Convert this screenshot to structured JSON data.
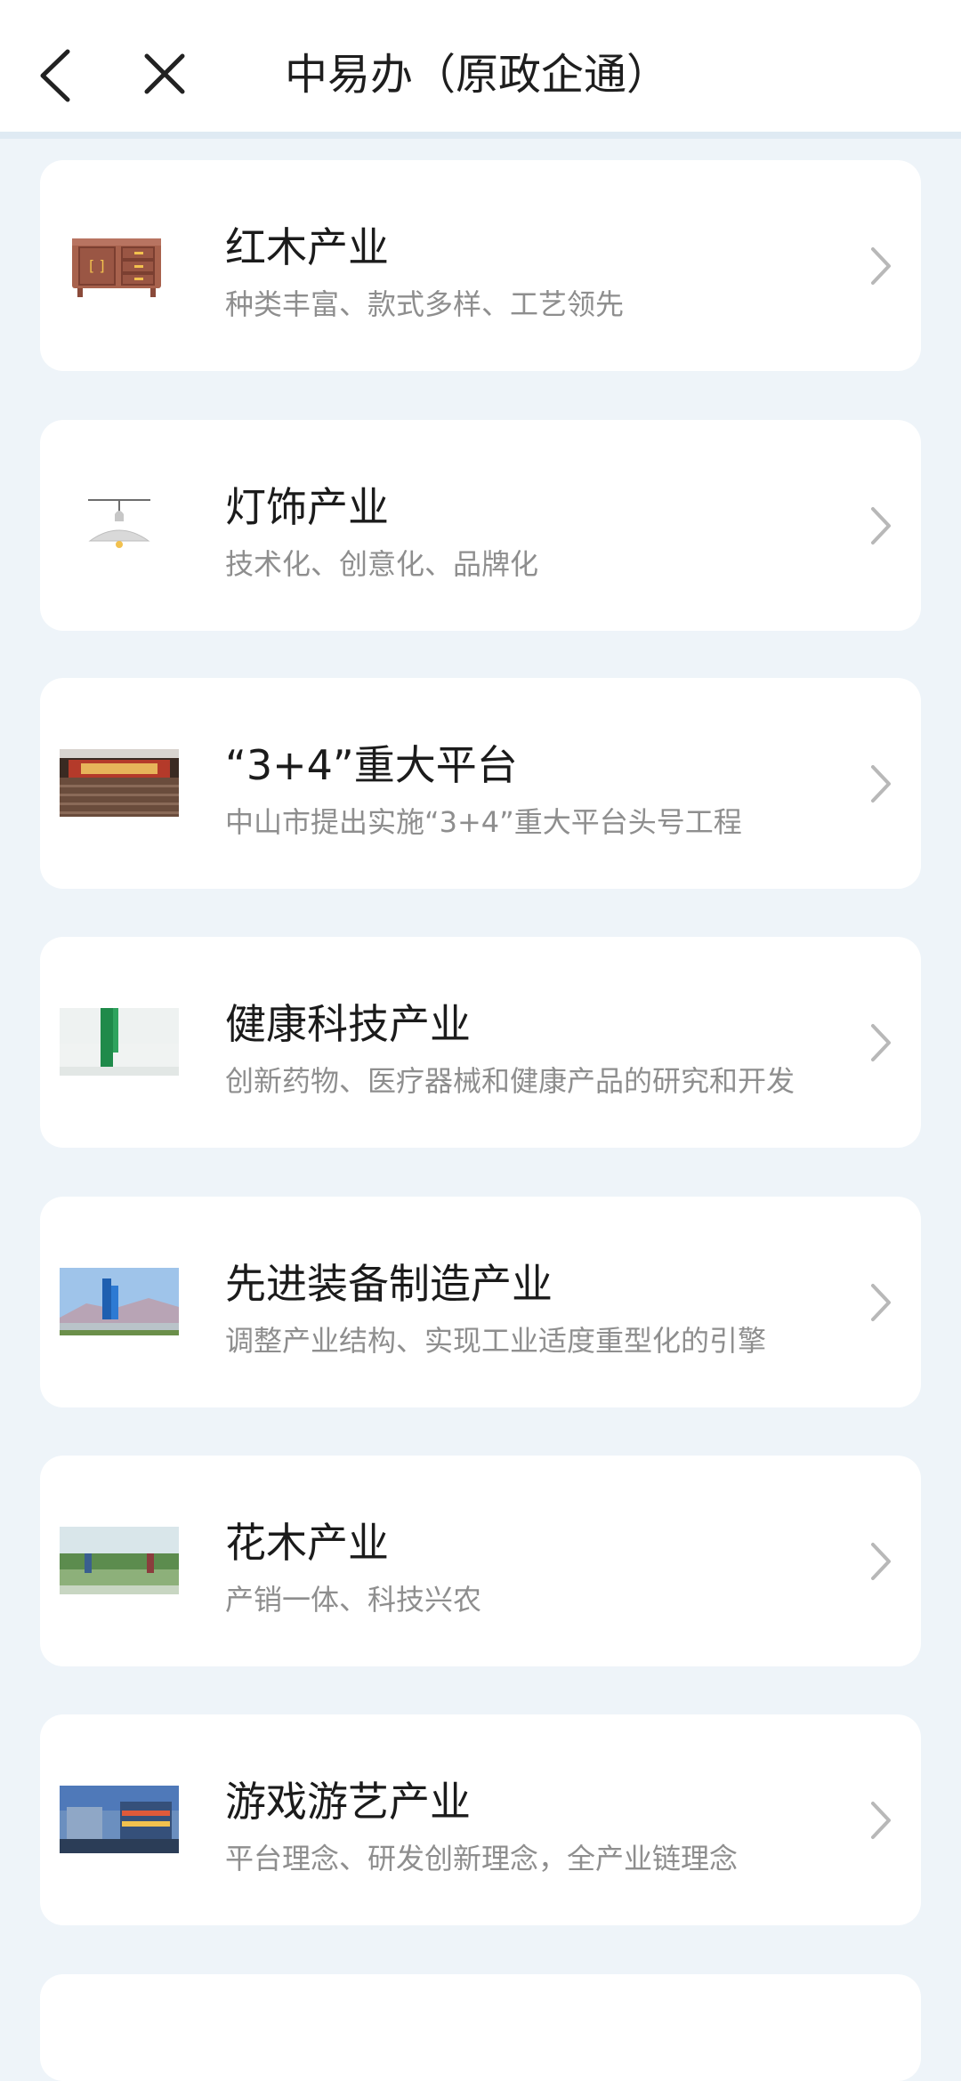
{
  "header": {
    "title": "中易办（原政企通）",
    "back_icon": "chevron-left-icon",
    "close_icon": "close-icon"
  },
  "items": [
    {
      "title": "红木产业",
      "subtitle": "种类丰富、款式多样、工艺领先",
      "thumb": "cabinet-image"
    },
    {
      "title": "灯饰产业",
      "subtitle": "技术化、创意化、品牌化",
      "thumb": "pendant-lamp-image"
    },
    {
      "title": "“3+4”重大平台",
      "subtitle": "中山市提出实施“3+4”重大平台头号工程",
      "thumb": "conference-hall-image"
    },
    {
      "title": "健康科技产业",
      "subtitle": "创新药物、医疗器械和健康产品的研究和开发",
      "thumb": "health-sign-image"
    },
    {
      "title": "先进装备制造产业",
      "subtitle": "调整产业结构、实现工业适度重型化的引擎",
      "thumb": "industrial-monument-image"
    },
    {
      "title": "花木产业",
      "subtitle": "产销一体、科技兴农",
      "thumb": "nursery-field-image"
    },
    {
      "title": "游戏游艺产业",
      "subtitle": "平台理念、研发创新理念，全产业链理念",
      "thumb": "amusement-building-image"
    }
  ],
  "colors": {
    "background": "#eef4f9",
    "card": "#ffffff",
    "title_text": "#1b1b1b",
    "subtitle_text": "#8e8e8e",
    "chevron": "#b8b8b8"
  }
}
